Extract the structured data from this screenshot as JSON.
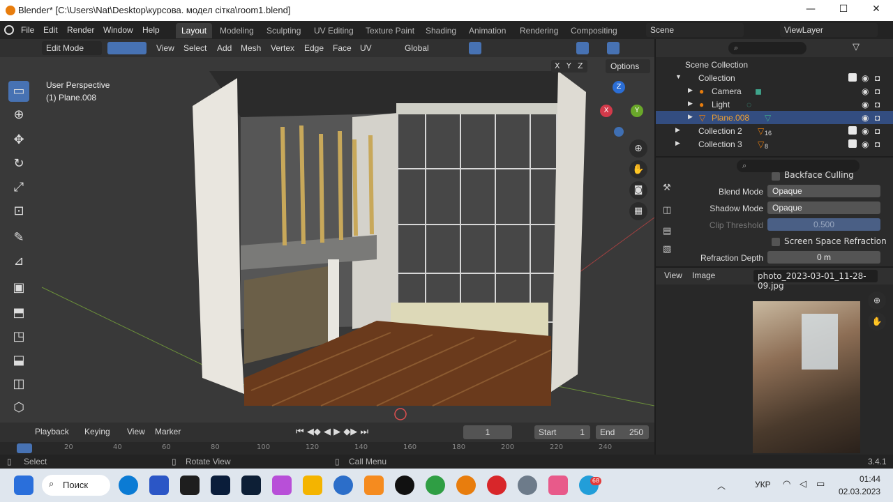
{
  "window": {
    "title": "Blender* [C:\\Users\\Nat\\Desktop\\курсова. модел сітка\\room1.blend]",
    "controls": {
      "minimize": "—",
      "maximize": "☐",
      "close": "✕"
    }
  },
  "menu": [
    "File",
    "Edit",
    "Render",
    "Window",
    "Help"
  ],
  "workspaces": [
    "Layout",
    "Modeling",
    "Sculpting",
    "UV Editing",
    "Texture Paint",
    "Shading",
    "Animation",
    "Rendering",
    "Compositing"
  ],
  "scene": {
    "name": "Scene",
    "view_layer": "ViewLayer"
  },
  "viewport_header": {
    "mode": "Edit Mode",
    "menus": [
      "View",
      "Select",
      "Add",
      "Mesh",
      "Vertex",
      "Edge",
      "Face",
      "UV"
    ],
    "orientation": "Global",
    "axes": [
      "X",
      "Y",
      "Z"
    ],
    "options": "Options"
  },
  "viewport": {
    "perspective": "User Perspective",
    "object": "(1) Plane.008",
    "gizmo": {
      "x": "X",
      "y": "Y",
      "z": "Z"
    }
  },
  "outliner": {
    "root": "Scene Collection",
    "rows": [
      {
        "label": "Collection",
        "count": ""
      },
      {
        "label": "Camera",
        "count": ""
      },
      {
        "label": "Light",
        "count": ""
      },
      {
        "label": "Plane.008",
        "count": ""
      },
      {
        "label": "Collection 2",
        "count": "16"
      },
      {
        "label": "Collection 3",
        "count": "8"
      }
    ]
  },
  "properties": {
    "backface": "Backface Culling",
    "blend_mode_label": "Blend Mode",
    "blend_mode": "Opaque",
    "shadow_mode_label": "Shadow Mode",
    "shadow_mode": "Opaque",
    "clip_label": "Clip Threshold",
    "clip_value": "0.500",
    "ssr_label": "Screen Space Refraction",
    "refraction_label": "Refraction Depth",
    "refraction_value": "0 m"
  },
  "image_editor": {
    "view": "View",
    "image": "Image",
    "filename": "photo_2023-03-01_11-28-09.jpg"
  },
  "timeline": {
    "playback": "Playback",
    "keying": "Keying",
    "view": "View",
    "marker": "Marker",
    "frame": "1",
    "start_label": "Start",
    "start": "1",
    "end_label": "End",
    "end": "250",
    "ticks": [
      "20",
      "40",
      "60",
      "80",
      "100",
      "120",
      "140",
      "160",
      "180",
      "200",
      "220",
      "240"
    ]
  },
  "statusbar": {
    "select": "Select",
    "rotate": "Rotate View",
    "call_menu": "Call Menu",
    "version": "3.4.1"
  },
  "taskbar": {
    "search": "Поиск",
    "lang": "УКР",
    "time": "01:44",
    "date": "02.03.2023",
    "badge": "68"
  },
  "colors": {
    "accent": "#4772b3",
    "selected_row": "#334d80",
    "orange": "#e87d0d"
  }
}
